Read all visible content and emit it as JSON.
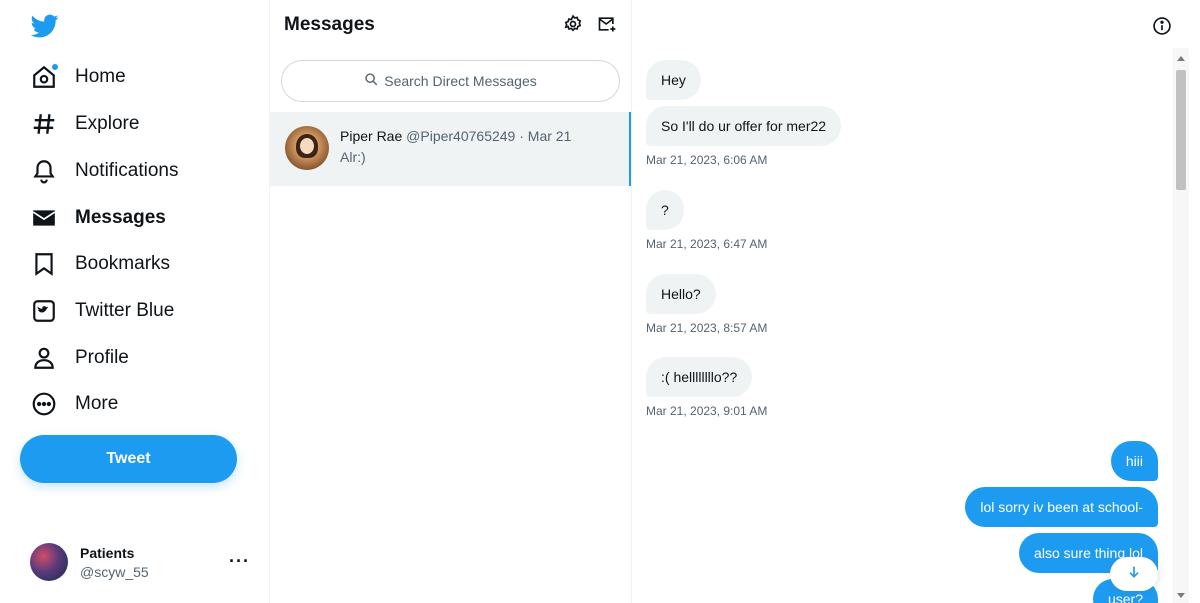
{
  "nav": {
    "items": [
      {
        "label": "Home",
        "icon": "home-icon",
        "badge": true
      },
      {
        "label": "Explore",
        "icon": "hashtag-icon"
      },
      {
        "label": "Notifications",
        "icon": "bell-icon"
      },
      {
        "label": "Messages",
        "icon": "envelope-icon",
        "active": true
      },
      {
        "label": "Bookmarks",
        "icon": "bookmark-icon"
      },
      {
        "label": "Twitter Blue",
        "icon": "twitter-blue-icon"
      },
      {
        "label": "Profile",
        "icon": "person-icon"
      },
      {
        "label": "More",
        "icon": "more-circle-icon"
      }
    ],
    "tweet_label": "Tweet",
    "account": {
      "name": "Patients",
      "handle": "@scyw_55",
      "more": "···"
    }
  },
  "list": {
    "title": "Messages",
    "search_placeholder": "Search Direct Messages",
    "conversations": [
      {
        "name": "Piper Rae",
        "meta": "@Piper40765249 · Mar 21",
        "preview": "Alr:)"
      }
    ]
  },
  "chat": {
    "messages": [
      {
        "dir": "in",
        "text": "Hey"
      },
      {
        "dir": "in",
        "text": "So I'll do ur offer for mer22",
        "time": "Mar 21, 2023, 6:06 AM"
      },
      {
        "dir": "in",
        "text": "?",
        "time": "Mar 21, 2023, 6:47 AM"
      },
      {
        "dir": "in",
        "text": "Hello?",
        "time": "Mar 21, 2023, 8:57 AM"
      },
      {
        "dir": "in",
        "text": ":( hellllllllo??",
        "time": "Mar 21, 2023, 9:01 AM"
      },
      {
        "dir": "out",
        "text": "hiii"
      },
      {
        "dir": "out",
        "text": "lol sorry iv been at school-"
      },
      {
        "dir": "out",
        "text": "also sure thing lol"
      },
      {
        "dir": "out",
        "text": "user?"
      }
    ]
  },
  "colors": {
    "accent": "#1d9bf0",
    "text": "#0f1419",
    "muted": "#536471",
    "bubble_in": "#eff3f4"
  }
}
